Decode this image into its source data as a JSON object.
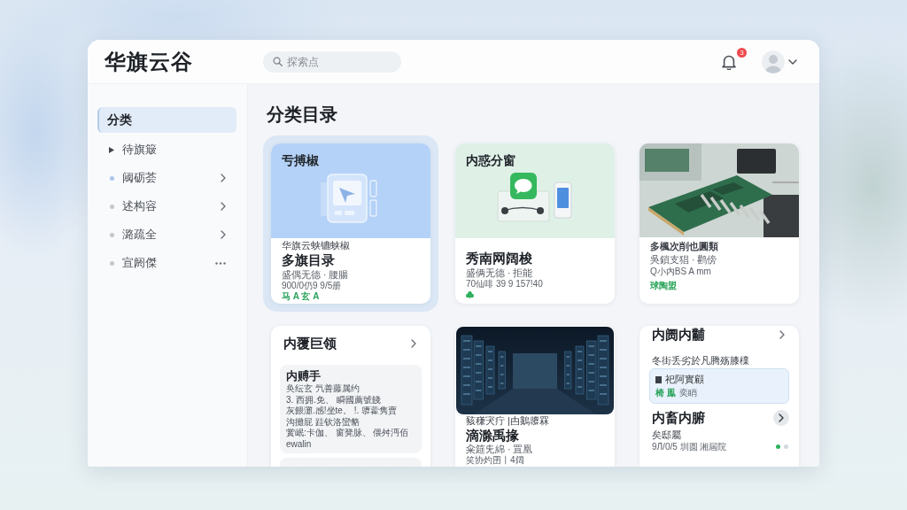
{
  "header": {
    "logo": "华旗云谷",
    "search": {
      "placeholder": "探索点"
    },
    "notification_count": "3"
  },
  "sidebar": {
    "items": [
      {
        "label": "分类",
        "selected": true,
        "kind": "plain"
      },
      {
        "label": "待旗簸",
        "selected": false,
        "kind": "caret"
      },
      {
        "label": "阈砺荟",
        "selected": false,
        "kind": "submenu",
        "color": "#a9c6ee"
      },
      {
        "label": "述构容",
        "selected": false,
        "kind": "submenu",
        "color": "#c3c7cc"
      },
      {
        "label": "潞疏全",
        "selected": false,
        "kind": "submenu",
        "color": "#c3c7cc"
      },
      {
        "label": "宣阏傑",
        "selected": false,
        "kind": "overflow",
        "color": "#c3c7cc"
      }
    ]
  },
  "main": {
    "title": "分类目录",
    "cards": [
      {
        "kind": "tablet",
        "selected": true,
        "color": "#b4d2f7",
        "banner_label": "亐搏椒",
        "caption": "华旗云蛱镳蛱椒",
        "title": "多旗目录",
        "meta": "盛偶无德 · 腰腸",
        "spec": "900/0仍9 9/5册",
        "tag": "马 A 玄 A"
      },
      {
        "kind": "chat",
        "selected": false,
        "color": "#dff1e7",
        "banner_label": "内惑分窗",
        "title": "秀南网阔梭",
        "meta": "盛俩无德 · 拒能",
        "spec": "70仙啡 39 9 157!40"
      },
      {
        "kind": "circuit",
        "selected": false,
        "caption": "多楓次削也圓類",
        "meta": "吳鎖支猖 · 鹳傍",
        "spec": "Q小内BS A mm",
        "tag": "球陶盟"
      },
      {
        "kind": "list",
        "selected": false,
        "title": "内覆巨领",
        "panel": {
          "heading": "内赙手",
          "lines": [
            "奂纭玄 氕善藤属约",
            "3. 西拥.免、 瞬國薦號餞",
            "灰餵灘.感!坐te。 !. 隳藿隽賣",
            "沟攤屁 跬钦洛蠻貉",
            "黉岷:卡伽、 窗凳脉、 偎舛沔佰",
            "ewalin"
          ]
        }
      },
      {
        "kind": "servers",
        "selected": false,
        "caption": "豥稴宊疔 |甴鵝隳罧",
        "title": "滴滁禹掾",
        "meta": "籴筵兂綿 · 罝凰",
        "spec": "笑协灼囝丨4阔"
      },
      {
        "kind": "detail",
        "selected": false,
        "title": "内阓内黼",
        "caption": "冬街丢劣於凡腾殇膝檏",
        "note": {
          "text": "祀阿實顧",
          "tag": "椅 鳯",
          "status": "奕睄"
        },
        "subtitle": "内畜内腑",
        "meta": "矣邸屬",
        "spec": "9Л/0/5 圳圆 湘屆院",
        "pager": [
          {
            "selected": true
          },
          {
            "selected": false
          }
        ]
      }
    ]
  }
}
